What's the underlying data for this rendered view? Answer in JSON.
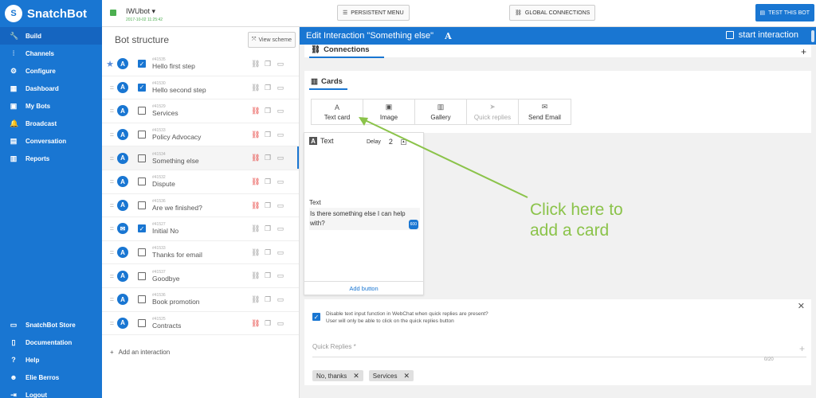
{
  "brand": {
    "name": "SnatchBot",
    "logo_letter": "S"
  },
  "sidebar": {
    "items": [
      {
        "label": "Build",
        "icon": "wrench-icon",
        "active": true
      },
      {
        "label": "Channels",
        "icon": "channels-icon"
      },
      {
        "label": "Configure",
        "icon": "gear-icon"
      },
      {
        "label": "Dashboard",
        "icon": "dashboard-icon"
      },
      {
        "label": "My Bots",
        "icon": "bots-icon"
      },
      {
        "label": "Broadcast",
        "icon": "bell-icon"
      },
      {
        "label": "Conversation",
        "icon": "chat-icon"
      },
      {
        "label": "Reports",
        "icon": "chart-icon"
      }
    ],
    "bottom": [
      {
        "label": "SnatchBot Store",
        "icon": "store-icon"
      },
      {
        "label": "Documentation",
        "icon": "document-icon"
      },
      {
        "label": "Help",
        "icon": "help-icon"
      },
      {
        "label": "Elie Berros",
        "icon": "user-icon"
      },
      {
        "label": "Logout",
        "icon": "logout-icon"
      }
    ]
  },
  "topbar": {
    "bot_name": "IWUbot",
    "bot_date": "2017-10-02 11:25:42",
    "persistent_menu": "PERSISTENT MENU",
    "global_connections": "GLOBAL CONNECTIONS",
    "test_bot": "TEST THIS BOT"
  },
  "structure": {
    "title": "Bot structure",
    "view_scheme": "View scheme",
    "add_interaction": "Add an interaction",
    "steps": [
      {
        "id": "#41535",
        "label": "Hello first step",
        "checked": true,
        "star": true,
        "avatar": "A",
        "link_red": false
      },
      {
        "id": "#41530",
        "label": "Hello second step",
        "checked": true,
        "avatar": "A",
        "link_red": false
      },
      {
        "id": "#41529",
        "label": "Services",
        "checked": false,
        "avatar": "A",
        "link_red": true
      },
      {
        "id": "#41533",
        "label": "Policy Advocacy",
        "checked": false,
        "avatar": "A",
        "link_red": true
      },
      {
        "id": "#41534",
        "label": "Something else",
        "checked": false,
        "avatar": "A",
        "link_red": true,
        "selected": true
      },
      {
        "id": "#41532",
        "label": "Dispute",
        "checked": false,
        "avatar": "A",
        "link_red": true
      },
      {
        "id": "#41536",
        "label": "Are we finished?",
        "checked": false,
        "avatar": "A",
        "link_red": true
      },
      {
        "id": "#41527",
        "label": "Initial No",
        "checked": true,
        "avatar": "✉",
        "link_red": false
      },
      {
        "id": "#41533",
        "label": "Thanks for email",
        "checked": false,
        "avatar": "A",
        "link_red": false
      },
      {
        "id": "#41537",
        "label": "Goodbye",
        "checked": false,
        "avatar": "A",
        "link_red": false
      },
      {
        "id": "#41536",
        "label": "Book promotion",
        "checked": false,
        "avatar": "A",
        "link_red": false
      },
      {
        "id": "#41525",
        "label": "Contracts",
        "checked": false,
        "avatar": "A",
        "link_red": true
      }
    ]
  },
  "editor": {
    "title": "Edit Interaction \"Something else\"",
    "type_icon": "A",
    "start_interaction": "start interaction",
    "connections": "Connections",
    "cards_title": "Cards",
    "tabs": [
      {
        "label": "Text card",
        "icon": "text-icon",
        "glyph": "A"
      },
      {
        "label": "Image",
        "icon": "image-icon",
        "glyph": "▣"
      },
      {
        "label": "Gallery",
        "icon": "gallery-icon",
        "glyph": "▥"
      },
      {
        "label": "Quick replies",
        "icon": "send-icon",
        "glyph": "➤",
        "disabled": true
      },
      {
        "label": "Send Email",
        "icon": "mail-icon",
        "glyph": "✉"
      }
    ],
    "card": {
      "header": "Text",
      "delay_label": "Delay",
      "delay_value": "2",
      "text_label": "Text",
      "text_value": "Is there something else I can help with?",
      "counter": "600",
      "add_button": "Add button"
    },
    "quick_replies": {
      "note_line1": "Disable text input function in WebChat when quick replies are present?",
      "note_line2": "User will only be able to click on the quick replies button",
      "placeholder": "Quick Replies *",
      "count": "0/20",
      "chips": [
        "No, thanks",
        "Services"
      ]
    }
  },
  "annotation": {
    "line1": "Click here to",
    "line2": "add a card",
    "color": "#8bc34a"
  }
}
